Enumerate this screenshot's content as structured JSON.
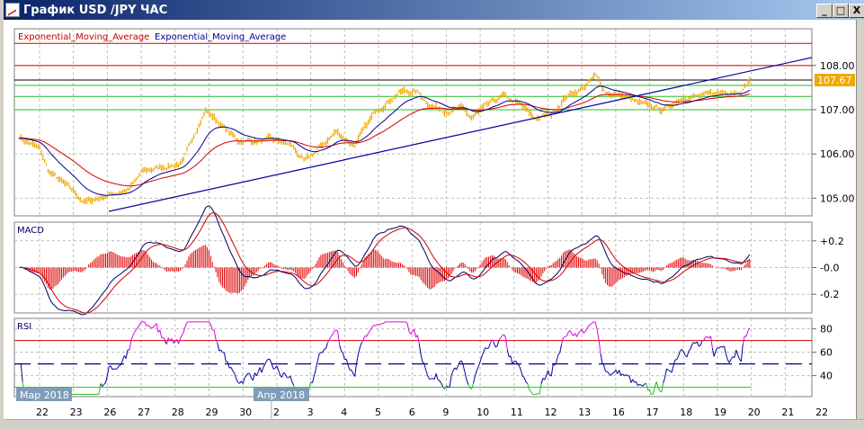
{
  "window": {
    "title": "График USD /JPY  ЧАС",
    "minimize": "_",
    "maximize": "□",
    "close": "X"
  },
  "legend": {
    "ema_slow": "Exponential_Moving_Average",
    "ema_fast": "Exponential_Moving_Average"
  },
  "colors": {
    "price": "#f0a800",
    "ema_slow": "#d00000",
    "ema_fast": "#000090",
    "trend": "#0000a0",
    "grid": "#bbbbbb",
    "level_red": "#d00000",
    "level_green": "#20c020",
    "overbought": "#e000e0",
    "month_badge": "#7f9db9"
  },
  "chart_data": [
    {
      "type": "line",
      "title": "USD/JPY",
      "x_tick_labels": [
        "22",
        "23",
        "26",
        "27",
        "28",
        "29",
        "30",
        "2",
        "3",
        "4",
        "5",
        "6",
        "9",
        "10",
        "11",
        "12",
        "13",
        "16",
        "17",
        "18",
        "19",
        "20",
        "21",
        "22"
      ],
      "month_labels": [
        {
          "label": "Мар 2018",
          "at_day_index": 0
        },
        {
          "label": "Апр 2018",
          "at_day_index": 7
        }
      ],
      "y_ticks": [
        "105.00",
        "106.00",
        "107.00",
        "108.00"
      ],
      "ylim": [
        104.6,
        108.83
      ],
      "last_price": "107.67",
      "price_points": [
        [
          -0.6,
          106.4
        ],
        [
          0,
          106.1
        ],
        [
          0.27,
          105.6
        ],
        [
          1.06,
          105.1
        ],
        [
          1.33,
          104.9
        ],
        [
          1.72,
          105.0
        ],
        [
          2.12,
          105.1
        ],
        [
          2.65,
          105.2
        ],
        [
          3.05,
          105.6
        ],
        [
          3.58,
          105.7
        ],
        [
          4.24,
          105.8
        ],
        [
          4.64,
          106.6
        ],
        [
          4.91,
          107.0
        ],
        [
          5.3,
          106.7
        ],
        [
          5.84,
          106.3
        ],
        [
          6.37,
          106.3
        ],
        [
          6.9,
          106.3
        ],
        [
          7.43,
          106.2
        ],
        [
          7.82,
          105.8
        ],
        [
          8.22,
          106.1
        ],
        [
          8.75,
          106.5
        ],
        [
          9.28,
          106.2
        ],
        [
          9.55,
          106.5
        ],
        [
          9.95,
          107.0
        ],
        [
          10.6,
          107.4
        ],
        [
          11.14,
          107.4
        ],
        [
          11.54,
          107.1
        ],
        [
          11.94,
          107.0
        ],
        [
          12.47,
          107.0
        ],
        [
          12.73,
          106.8
        ],
        [
          13.26,
          107.1
        ],
        [
          13.66,
          107.3
        ],
        [
          14.19,
          107.1
        ],
        [
          14.59,
          106.8
        ],
        [
          15.12,
          106.9
        ],
        [
          15.52,
          107.3
        ],
        [
          16.05,
          107.5
        ],
        [
          16.4,
          107.75
        ],
        [
          16.71,
          107.4
        ],
        [
          17.24,
          107.3
        ],
        [
          17.77,
          107.1
        ],
        [
          18.44,
          107.0
        ],
        [
          18.97,
          107.3
        ],
        [
          19.63,
          107.3
        ],
        [
          20.16,
          107.4
        ],
        [
          20.69,
          107.45
        ],
        [
          20.96,
          107.67
        ]
      ],
      "horizontal_levels": [
        {
          "value": 108.5,
          "color": "red"
        },
        {
          "value": 108.0,
          "color": "red"
        },
        {
          "value": 107.67,
          "color": "black"
        },
        {
          "value": 107.55,
          "color": "green"
        },
        {
          "value": 107.3,
          "color": "green"
        },
        {
          "value": 107.0,
          "color": "green"
        }
      ],
      "trendline": [
        [
          2.04,
          104.7
        ],
        [
          22.2,
          108.18
        ]
      ],
      "series": [
        {
          "name": "Exponential_Moving_Average",
          "color": "red"
        },
        {
          "name": "Exponential_Moving_Average",
          "color": "blue"
        }
      ]
    },
    {
      "type": "line",
      "title": "MACD",
      "y_ticks": [
        "+0.2",
        "-0.0",
        "-0.2"
      ],
      "ylim": [
        -0.34,
        0.34
      ]
    },
    {
      "type": "line",
      "title": "RSI",
      "y_ticks": [
        "80",
        "60",
        "40"
      ],
      "ylim": [
        22,
        89
      ],
      "levels": [
        70,
        50,
        30
      ]
    }
  ]
}
